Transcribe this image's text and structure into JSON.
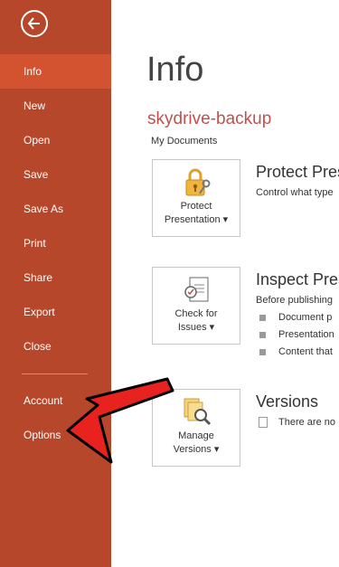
{
  "sidebar": {
    "items": [
      {
        "label": "Info"
      },
      {
        "label": "New"
      },
      {
        "label": "Open"
      },
      {
        "label": "Save"
      },
      {
        "label": "Save As"
      },
      {
        "label": "Print"
      },
      {
        "label": "Share"
      },
      {
        "label": "Export"
      },
      {
        "label": "Close"
      },
      {
        "label": "Account"
      },
      {
        "label": "Options"
      }
    ],
    "active": "Info"
  },
  "main": {
    "title": "Info",
    "doc_name": "skydrive-backup",
    "doc_path": "My Documents",
    "protect": {
      "button_line1": "Protect",
      "button_line2": "Presentation ▾",
      "title": "Protect Pres",
      "desc": "Control what type"
    },
    "inspect": {
      "button_line1": "Check for",
      "button_line2": "Issues ▾",
      "title": "Inspect Pres",
      "desc": "Before publishing",
      "bullets": [
        "Document p",
        "Presentation",
        "Content that"
      ]
    },
    "versions": {
      "button_line1": "Manage",
      "button_line2": "Versions ▾",
      "title": "Versions",
      "desc": "There are no"
    }
  },
  "colors": {
    "sidebar_bg": "#b7472a",
    "sidebar_active": "#d35230",
    "doc_name": "#c0504d",
    "annotation_arrow": "#e8231f"
  }
}
